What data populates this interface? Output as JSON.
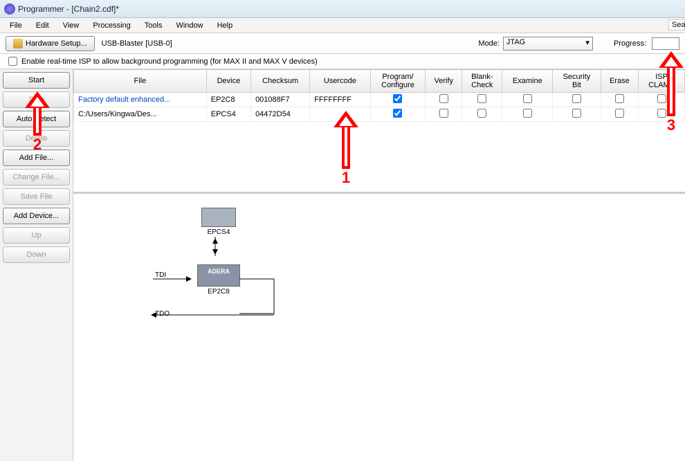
{
  "title": "Programmer - [Chain2.cdf]*",
  "menu": [
    "File",
    "Edit",
    "View",
    "Processing",
    "Tools",
    "Window",
    "Help"
  ],
  "search_stub": "Sear",
  "toolbar": {
    "hw_setup": "Hardware Setup...",
    "hw_label": "USB-Blaster [USB-0]",
    "mode_label": "Mode:",
    "mode_value": "JTAG",
    "progress_label": "Progress:"
  },
  "isp_label": "Enable real-time ISP to allow background programming (for MAX II and MAX V devices)",
  "side": [
    {
      "label": "Start",
      "dis": false
    },
    {
      "label": "Stop",
      "dis": true
    },
    {
      "label": "Auto Detect",
      "dis": false
    },
    {
      "label": "Delete",
      "dis": true
    },
    {
      "label": "Add File...",
      "dis": false
    },
    {
      "label": "Change File...",
      "dis": true
    },
    {
      "label": "Save File",
      "dis": true
    },
    {
      "label": "Add Device...",
      "dis": false
    },
    {
      "label": "Up",
      "dis": true
    },
    {
      "label": "Down",
      "dis": true
    }
  ],
  "cols": [
    "File",
    "Device",
    "Checksum",
    "Usercode",
    "Program/\nConfigure",
    "Verify",
    "Blank-\nCheck",
    "Examine",
    "Security\nBit",
    "Erase",
    "ISP\nCLAMP"
  ],
  "rows": [
    {
      "file": "Factory default enhanced...",
      "device": "EP2C8",
      "checksum": "001088F7",
      "usercode": "FFFFFFFF",
      "prog": true,
      "link": true
    },
    {
      "file": "C:/Users/Kingwa/Des...",
      "device": "EPCS4",
      "checksum": "04472D54",
      "usercode": "",
      "prog": true,
      "link": false
    }
  ],
  "canvas": {
    "chip_top": "EPCS4",
    "chip_bot": "EP2C8",
    "altera": "ADERA",
    "tdi": "TDI",
    "tdo": "TDO"
  },
  "annots": {
    "a1": "1",
    "a2": "2",
    "a3": "3"
  }
}
